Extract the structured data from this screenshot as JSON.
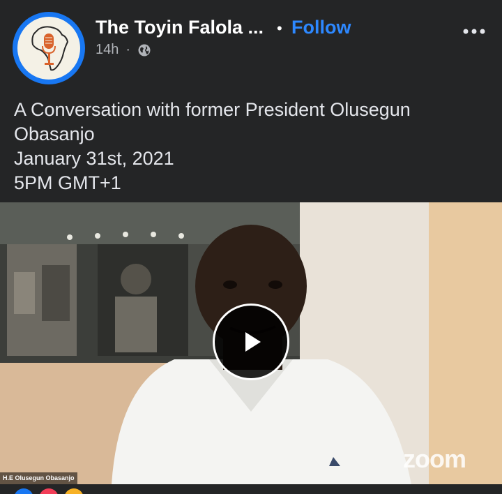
{
  "post": {
    "page_name": "The Toyin Falola ...",
    "separator": "•",
    "follow_label": "Follow",
    "time": "14h",
    "meta_separator": "·",
    "privacy_icon": "globe-icon",
    "more_icon": "more-options-icon"
  },
  "caption": {
    "lines": [
      "A Conversation with former President Olusegun",
      "Obasanjo",
      "January 31st, 2021",
      "5PM GMT+1"
    ]
  },
  "video": {
    "play_icon": "play-icon",
    "watermark": "zoom",
    "participant_name": "H.E Olusegun Obasanjo"
  },
  "colors": {
    "background": "#242526",
    "accent": "#2d88ff",
    "avatar_ring": "#1877f2",
    "text_primary": "#ffffff",
    "text_secondary": "#b0b3b8"
  }
}
